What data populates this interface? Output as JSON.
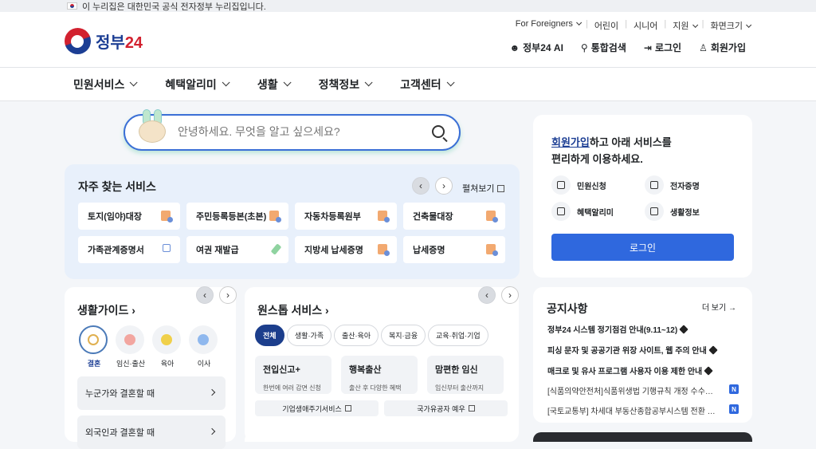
{
  "topbar": {
    "text": "이 누리집은 대한민국 공식 전자정부 누리집입니다."
  },
  "logo": {
    "text_main": "정부",
    "text_num": "24"
  },
  "util_top": [
    "For Foreigners",
    "어린이",
    "시니어",
    "지원",
    "화면크기"
  ],
  "util_bottom": [
    "정부24 AI",
    "통합검색",
    "로그인",
    "회원가입"
  ],
  "nav": [
    "민원서비스",
    "혜택알리미",
    "생활",
    "정책정보",
    "고객센터"
  ],
  "search": {
    "placeholder": "안녕하세요. 무엇을 알고 싶으세요?"
  },
  "frequent": {
    "title": "자주 찾는 서비스",
    "expand": "펼쳐보기",
    "items": [
      "토지(임야)대장",
      "주민등록등본(초본)",
      "자동차등록원부",
      "건축물대장",
      "가족관계증명서",
      "여권 재발급",
      "지방세 납세증명",
      "납세증명"
    ]
  },
  "login": {
    "link": "회원가입",
    "line1": "하고 아래 서비스를",
    "line2": "편리하게 이용하세요.",
    "items": [
      "민원신청",
      "전자증명",
      "혜택알리미",
      "생활정보"
    ],
    "button": "로그인"
  },
  "life": {
    "title": "생활가이드",
    "cats": [
      "결혼",
      "임신·출산",
      "육아",
      "이사"
    ],
    "rows": [
      "누군가와 결혼할 때",
      "외국인과 결혼할 때"
    ]
  },
  "onestop": {
    "title": "원스톱 서비스",
    "chips": [
      "전체",
      "생활·가족",
      "출산·육아",
      "복지·금융",
      "교육·취업·기업"
    ],
    "cards": [
      {
        "title": "전입신고+",
        "desc": "한번에 여러 감면 신청"
      },
      {
        "title": "행복출산",
        "desc": "출산 후 다양한 혜택"
      },
      {
        "title": "맘편한 임신",
        "desc": "임신부터 출산까지"
      }
    ],
    "links": [
      "기업생애주기서비스",
      "국가유공자 예우"
    ]
  },
  "notice": {
    "title": "공지사항",
    "more": "더 보기",
    "items": [
      "정부24 시스템 정기점검 안내(9.11~12)",
      "피싱 문자 및 공공기관 위장 사이트, 웹 주의 안내",
      "매크로 및 유사 프로그램 사용자 이용 제한 안내",
      "[식품의약안전처]식품위생법 기행규칙 개정 수수료 안내",
      "[국토교통부] 차세대 부동산종합공부시스템 전환 안내"
    ],
    "badge": "N"
  }
}
